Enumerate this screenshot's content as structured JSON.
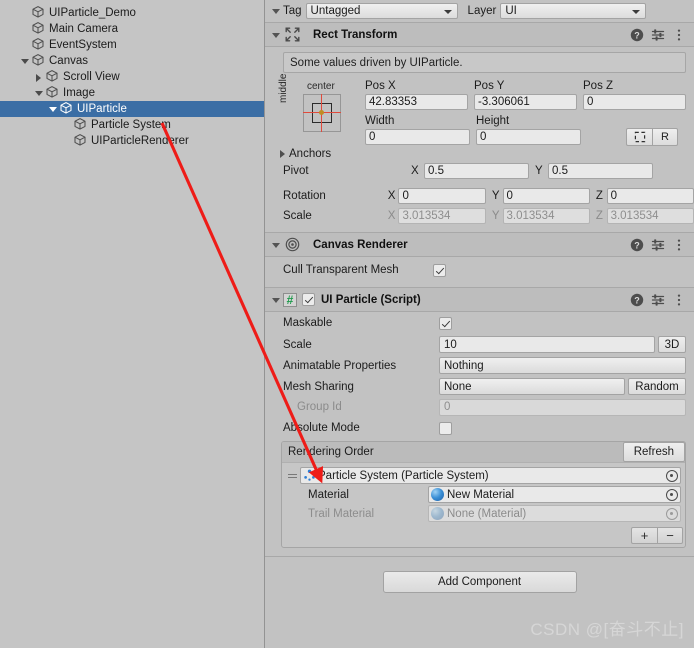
{
  "hierarchy": {
    "name": "scene-hierarchy",
    "rows": [
      {
        "label": "",
        "depth": 0,
        "twisty": "open",
        "clipped": true,
        "selected": false
      },
      {
        "label": "UIParticle_Demo",
        "depth": 1,
        "twisty": "none",
        "selected": false
      },
      {
        "label": "Main Camera",
        "depth": 1,
        "twisty": "none",
        "selected": false
      },
      {
        "label": "EventSystem",
        "depth": 1,
        "twisty": "none",
        "selected": false
      },
      {
        "label": "Canvas",
        "depth": 1,
        "twisty": "open",
        "selected": false
      },
      {
        "label": "Scroll View",
        "depth": 2,
        "twisty": "closed",
        "selected": false
      },
      {
        "label": "Image",
        "depth": 2,
        "twisty": "open",
        "selected": false
      },
      {
        "label": "UIParticle",
        "depth": 3,
        "twisty": "open",
        "selected": true
      },
      {
        "label": "Particle System",
        "depth": 4,
        "twisty": "none",
        "selected": false
      },
      {
        "label": "UIParticleRenderer",
        "depth": 4,
        "twisty": "none",
        "selected": false
      }
    ]
  },
  "inspector": {
    "tagline": {
      "tag_label": "Tag",
      "tag_value": "Untagged",
      "layer_label": "Layer",
      "layer_value": "UI"
    },
    "rect_transform": {
      "title": "Rect Transform",
      "helpbox": "Some values driven by UIParticle.",
      "anchor_preset": {
        "horizontal": "center",
        "vertical": "middle"
      },
      "pos_headers": [
        "Pos X",
        "Pos Y",
        "Pos Z"
      ],
      "pos_values": [
        "42.83353",
        "-3.306061",
        "0"
      ],
      "size_headers": [
        "Width",
        "Height"
      ],
      "size_values": [
        "0",
        "0"
      ],
      "blueprint_button": "blueprint-mode-icon",
      "raw_button": "R",
      "anchors_label": "Anchors",
      "pivot_label": "Pivot",
      "pivot_axes": [
        "X",
        "Y"
      ],
      "pivot_values": [
        "0.5",
        "0.5"
      ],
      "rotation_label": "Rotation",
      "rotation_axes": [
        "X",
        "Y",
        "Z"
      ],
      "rotation_values": [
        "0",
        "0",
        "0"
      ],
      "scale_label": "Scale",
      "scale_axes": [
        "X",
        "Y",
        "Z"
      ],
      "scale_values": [
        "3.013534",
        "3.013534",
        "3.013534"
      ]
    },
    "canvas_renderer": {
      "title": "Canvas Renderer",
      "cull_label": "Cull Transparent Mesh",
      "cull_checked": true
    },
    "ui_particle": {
      "title": "UI Particle (Script)",
      "enabled": true,
      "maskable_label": "Maskable",
      "maskable_checked": true,
      "scale_label": "Scale",
      "scale_value": "10",
      "scale_3d_button": "3D",
      "animatable_label": "Animatable Properties",
      "animatable_value": "Nothing",
      "mesh_sharing_label": "Mesh Sharing",
      "mesh_sharing_value": "None",
      "random_button": "Random",
      "group_id_label": "Group Id",
      "group_id_value": "0",
      "absolute_mode_label": "Absolute Mode",
      "absolute_mode_checked": false,
      "rendering_order": {
        "title": "Rendering Order",
        "refresh_button": "Refresh",
        "entry": "Particle System (Particle System)",
        "material_label": "Material",
        "material_value": "New Material",
        "trail_material_label": "Trail Material",
        "trail_material_value": "None (Material)",
        "add_button": "+",
        "remove_button": "−"
      }
    },
    "add_component_button": "Add Component",
    "watermark": "CSDN @[奋斗不止]"
  },
  "colors": {
    "selection_blue": "#3b6ea5",
    "panel_bg": "#c2c2c2",
    "hierarchy_bg": "#c5c5c5",
    "arrow_red": "#ee1c18",
    "script_green": "#1d9a4b"
  }
}
